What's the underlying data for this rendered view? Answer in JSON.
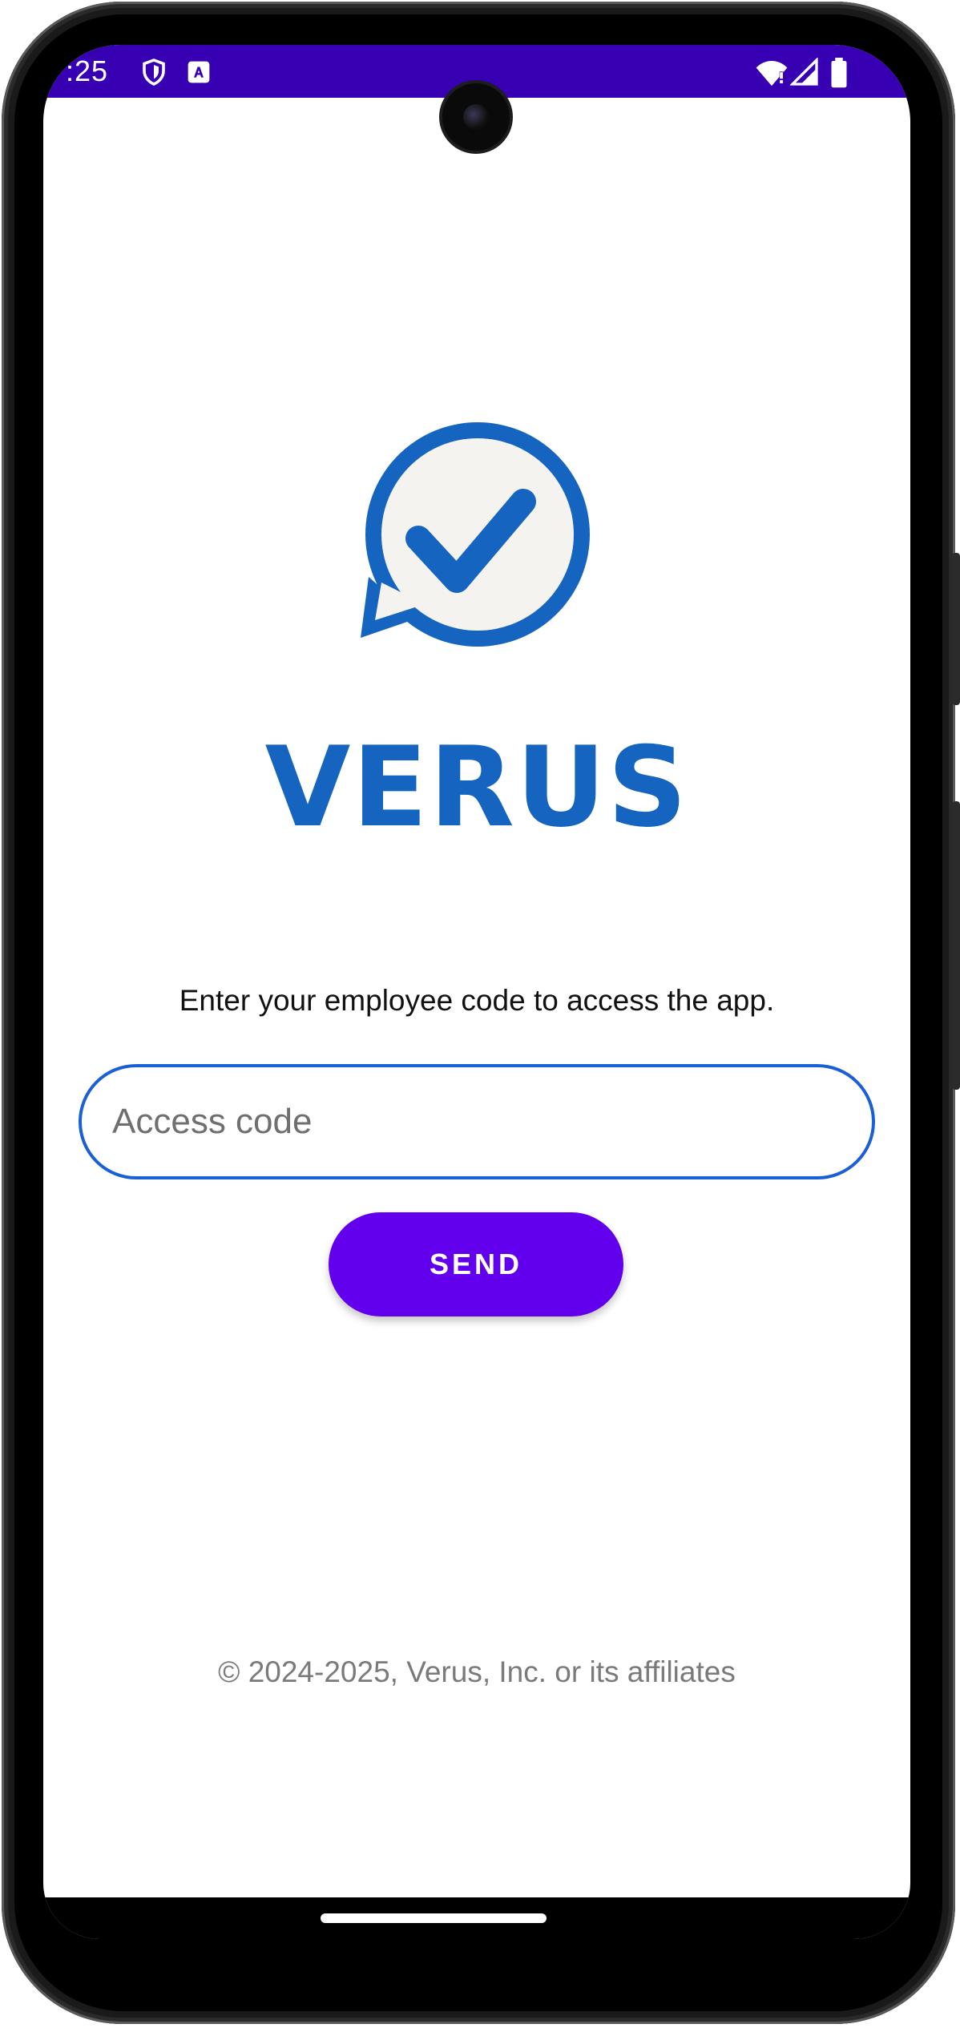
{
  "status_bar": {
    "time": ":25",
    "background_color": "#3700b3",
    "left_icons": [
      "shield-icon",
      "a-badge-icon"
    ],
    "right_icons": [
      "wifi-icon",
      "signal-icon",
      "battery-icon"
    ]
  },
  "app": {
    "logo_icon": "chat-check-icon",
    "brand_name": "VERUS",
    "brand_color": "#1565c0"
  },
  "login": {
    "prompt": "Enter your employee code to access the app.",
    "input_placeholder": "Access code",
    "input_value": "",
    "send_label": "SEND",
    "send_color": "#6200ee",
    "input_border_color": "#1a5fd6"
  },
  "footer": {
    "copyright": "© 2024-2025, Verus, Inc. or its affiliates"
  }
}
